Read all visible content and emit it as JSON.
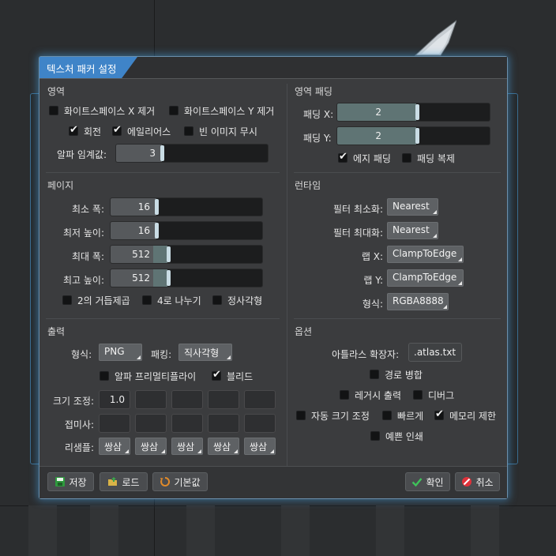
{
  "dialog": {
    "title": "텍스처 패커 설정"
  },
  "area": {
    "title": "영역",
    "whitespace_x": {
      "label": "화이트스페이스 X 제거",
      "checked": false
    },
    "whitespace_y": {
      "label": "화이트스페이스 Y 제거",
      "checked": false
    },
    "rotation": {
      "label": "회전",
      "checked": true
    },
    "aliases": {
      "label": "에일리어스",
      "checked": true
    },
    "ignore_blank": {
      "label": "빈 이미지 무시",
      "checked": false
    },
    "alpha_threshold": {
      "label": "알파 임계값:",
      "value": "3",
      "fraction": 0.3
    }
  },
  "area_padding": {
    "title": "영역 패딩",
    "padding_x": {
      "label": "패딩 X:",
      "value": "2",
      "fraction": 0.5
    },
    "padding_y": {
      "label": "패딩 Y:",
      "value": "2",
      "fraction": 0.5
    },
    "edge_padding": {
      "label": "에지 패딩",
      "checked": true
    },
    "duplicate_padding": {
      "label": "패딩 복제",
      "checked": false
    }
  },
  "pages": {
    "title": "페이지",
    "min_width": {
      "label": "최소 폭:",
      "value": "16"
    },
    "min_height": {
      "label": "최저 높이:",
      "value": "16"
    },
    "max_width": {
      "label": "최대 폭:",
      "value": "512"
    },
    "max_height": {
      "label": "최고 높이:",
      "value": "512"
    },
    "pot": {
      "label": "2의 거듭제곱",
      "checked": false
    },
    "mult4": {
      "label": "4로 나누기",
      "checked": false
    },
    "square": {
      "label": "정사각형",
      "checked": false
    }
  },
  "runtime": {
    "title": "런타임",
    "filter_min": {
      "label": "필터 최소화:",
      "value": "Nearest"
    },
    "filter_mag": {
      "label": "필터 최대화:",
      "value": "Nearest"
    },
    "wrap_x": {
      "label": "랩 X:",
      "value": "ClampToEdge"
    },
    "wrap_y": {
      "label": "랩 Y:",
      "value": "ClampToEdge"
    },
    "format": {
      "label": "형식:",
      "value": "RGBA8888"
    }
  },
  "output": {
    "title": "출력",
    "format_label": "형식:",
    "format_value": "PNG",
    "packing_label": "패킹:",
    "packing_value": "직사각형",
    "premultiply": {
      "label": "알파 프리멀티플라이",
      "checked": false
    },
    "bleed": {
      "label": "블리드",
      "checked": true
    },
    "scale_label": "크기 조정:",
    "scale_values": [
      "1.0",
      "",
      "",
      "",
      ""
    ],
    "suffix_label": "접미사:",
    "suffix_values": [
      "",
      "",
      "",
      "",
      ""
    ],
    "resample_label": "리샘플:",
    "resample_values": [
      "쌍삼",
      "쌍삼",
      "쌍삼",
      "쌍삼",
      "쌍삼"
    ]
  },
  "options": {
    "title": "옵션",
    "atlas_ext_label": "아틀라스 확장자:",
    "atlas_ext_value": ".atlas.txt",
    "combine_paths": {
      "label": "경로 병합",
      "checked": false
    },
    "legacy_output": {
      "label": "레거시 출력",
      "checked": false
    },
    "debug": {
      "label": "디버그",
      "checked": false
    },
    "auto_scale": {
      "label": "자동 크기 조정",
      "checked": false
    },
    "fast": {
      "label": "빠르게",
      "checked": false
    },
    "limit_memory": {
      "label": "메모리 제한",
      "checked": true
    },
    "pretty_print": {
      "label": "예쁜 인쇄",
      "checked": false
    }
  },
  "buttons": {
    "save": "저장",
    "load": "로드",
    "defaults": "기본값",
    "ok": "확인",
    "cancel": "취소"
  },
  "colors": {
    "accent": "#3f84c8",
    "glow": "#4696d2",
    "panel": "#3b3c3e"
  }
}
